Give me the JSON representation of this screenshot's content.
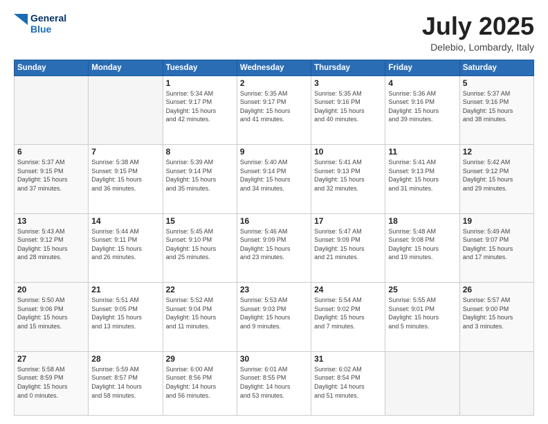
{
  "header": {
    "logo": {
      "line1": "General",
      "line2": "Blue"
    },
    "title": "July 2025",
    "subtitle": "Delebio, Lombardy, Italy"
  },
  "days_of_week": [
    "Sunday",
    "Monday",
    "Tuesday",
    "Wednesday",
    "Thursday",
    "Friday",
    "Saturday"
  ],
  "weeks": [
    [
      {
        "day": "",
        "info": ""
      },
      {
        "day": "",
        "info": ""
      },
      {
        "day": "1",
        "info": "Sunrise: 5:34 AM\nSunset: 9:17 PM\nDaylight: 15 hours\nand 42 minutes."
      },
      {
        "day": "2",
        "info": "Sunrise: 5:35 AM\nSunset: 9:17 PM\nDaylight: 15 hours\nand 41 minutes."
      },
      {
        "day": "3",
        "info": "Sunrise: 5:35 AM\nSunset: 9:16 PM\nDaylight: 15 hours\nand 40 minutes."
      },
      {
        "day": "4",
        "info": "Sunrise: 5:36 AM\nSunset: 9:16 PM\nDaylight: 15 hours\nand 39 minutes."
      },
      {
        "day": "5",
        "info": "Sunrise: 5:37 AM\nSunset: 9:16 PM\nDaylight: 15 hours\nand 38 minutes."
      }
    ],
    [
      {
        "day": "6",
        "info": "Sunrise: 5:37 AM\nSunset: 9:15 PM\nDaylight: 15 hours\nand 37 minutes."
      },
      {
        "day": "7",
        "info": "Sunrise: 5:38 AM\nSunset: 9:15 PM\nDaylight: 15 hours\nand 36 minutes."
      },
      {
        "day": "8",
        "info": "Sunrise: 5:39 AM\nSunset: 9:14 PM\nDaylight: 15 hours\nand 35 minutes."
      },
      {
        "day": "9",
        "info": "Sunrise: 5:40 AM\nSunset: 9:14 PM\nDaylight: 15 hours\nand 34 minutes."
      },
      {
        "day": "10",
        "info": "Sunrise: 5:41 AM\nSunset: 9:13 PM\nDaylight: 15 hours\nand 32 minutes."
      },
      {
        "day": "11",
        "info": "Sunrise: 5:41 AM\nSunset: 9:13 PM\nDaylight: 15 hours\nand 31 minutes."
      },
      {
        "day": "12",
        "info": "Sunrise: 5:42 AM\nSunset: 9:12 PM\nDaylight: 15 hours\nand 29 minutes."
      }
    ],
    [
      {
        "day": "13",
        "info": "Sunrise: 5:43 AM\nSunset: 9:12 PM\nDaylight: 15 hours\nand 28 minutes."
      },
      {
        "day": "14",
        "info": "Sunrise: 5:44 AM\nSunset: 9:11 PM\nDaylight: 15 hours\nand 26 minutes."
      },
      {
        "day": "15",
        "info": "Sunrise: 5:45 AM\nSunset: 9:10 PM\nDaylight: 15 hours\nand 25 minutes."
      },
      {
        "day": "16",
        "info": "Sunrise: 5:46 AM\nSunset: 9:09 PM\nDaylight: 15 hours\nand 23 minutes."
      },
      {
        "day": "17",
        "info": "Sunrise: 5:47 AM\nSunset: 9:09 PM\nDaylight: 15 hours\nand 21 minutes."
      },
      {
        "day": "18",
        "info": "Sunrise: 5:48 AM\nSunset: 9:08 PM\nDaylight: 15 hours\nand 19 minutes."
      },
      {
        "day": "19",
        "info": "Sunrise: 5:49 AM\nSunset: 9:07 PM\nDaylight: 15 hours\nand 17 minutes."
      }
    ],
    [
      {
        "day": "20",
        "info": "Sunrise: 5:50 AM\nSunset: 9:06 PM\nDaylight: 15 hours\nand 15 minutes."
      },
      {
        "day": "21",
        "info": "Sunrise: 5:51 AM\nSunset: 9:05 PM\nDaylight: 15 hours\nand 13 minutes."
      },
      {
        "day": "22",
        "info": "Sunrise: 5:52 AM\nSunset: 9:04 PM\nDaylight: 15 hours\nand 11 minutes."
      },
      {
        "day": "23",
        "info": "Sunrise: 5:53 AM\nSunset: 9:03 PM\nDaylight: 15 hours\nand 9 minutes."
      },
      {
        "day": "24",
        "info": "Sunrise: 5:54 AM\nSunset: 9:02 PM\nDaylight: 15 hours\nand 7 minutes."
      },
      {
        "day": "25",
        "info": "Sunrise: 5:55 AM\nSunset: 9:01 PM\nDaylight: 15 hours\nand 5 minutes."
      },
      {
        "day": "26",
        "info": "Sunrise: 5:57 AM\nSunset: 9:00 PM\nDaylight: 15 hours\nand 3 minutes."
      }
    ],
    [
      {
        "day": "27",
        "info": "Sunrise: 5:58 AM\nSunset: 8:59 PM\nDaylight: 15 hours\nand 0 minutes."
      },
      {
        "day": "28",
        "info": "Sunrise: 5:59 AM\nSunset: 8:57 PM\nDaylight: 14 hours\nand 58 minutes."
      },
      {
        "day": "29",
        "info": "Sunrise: 6:00 AM\nSunset: 8:56 PM\nDaylight: 14 hours\nand 56 minutes."
      },
      {
        "day": "30",
        "info": "Sunrise: 6:01 AM\nSunset: 8:55 PM\nDaylight: 14 hours\nand 53 minutes."
      },
      {
        "day": "31",
        "info": "Sunrise: 6:02 AM\nSunset: 8:54 PM\nDaylight: 14 hours\nand 51 minutes."
      },
      {
        "day": "",
        "info": ""
      },
      {
        "day": "",
        "info": ""
      }
    ]
  ]
}
